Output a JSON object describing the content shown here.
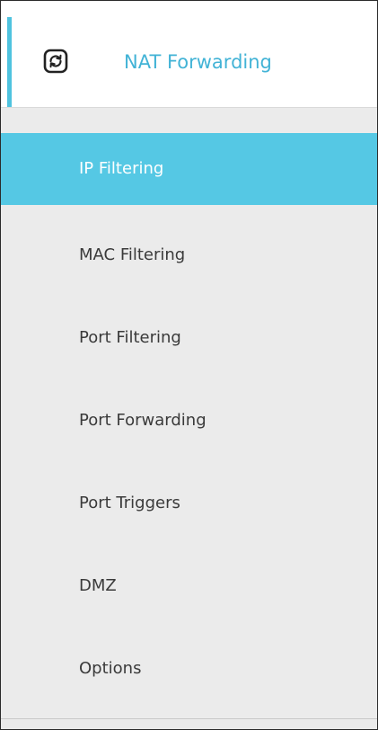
{
  "header": {
    "title": "NAT Forwarding",
    "icon": "nat-forwarding-icon",
    "accent_color": "#4fc3df",
    "title_color": "#42b3d6"
  },
  "menu": {
    "active_color": "#55c8e4",
    "items": [
      {
        "label": "IP Filtering",
        "active": true
      },
      {
        "label": "MAC Filtering",
        "active": false
      },
      {
        "label": "Port Filtering",
        "active": false
      },
      {
        "label": "Port Forwarding",
        "active": false
      },
      {
        "label": "Port Triggers",
        "active": false
      },
      {
        "label": "DMZ",
        "active": false
      },
      {
        "label": "Options",
        "active": false
      }
    ]
  }
}
